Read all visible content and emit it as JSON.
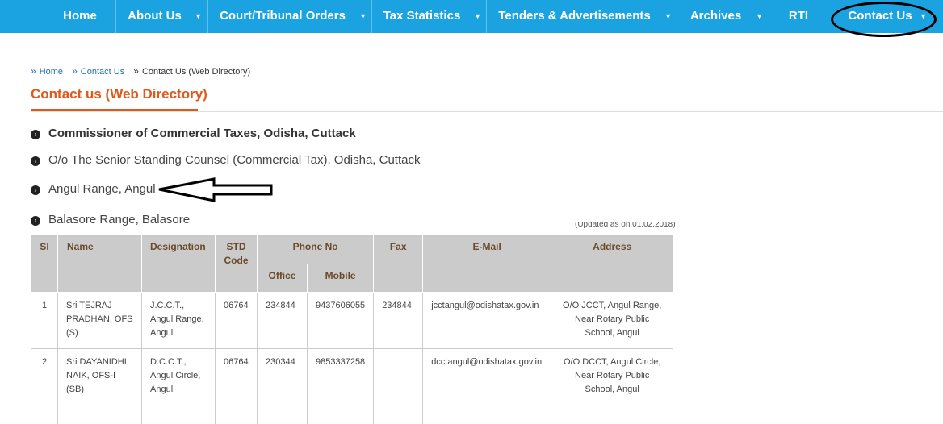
{
  "nav": {
    "items": [
      {
        "label": "Home",
        "dropdown": false
      },
      {
        "label": "About Us",
        "dropdown": true
      },
      {
        "label": "Court/Tribunal Orders",
        "dropdown": true
      },
      {
        "label": "Tax Statistics",
        "dropdown": true
      },
      {
        "label": "Tenders & Advertisements",
        "dropdown": true
      },
      {
        "label": "Archives",
        "dropdown": true
      },
      {
        "label": "RTI",
        "dropdown": false
      },
      {
        "label": "Contact Us",
        "dropdown": true
      }
    ],
    "caret": "▼",
    "bg_color": "#1aa3e0"
  },
  "breadcrumb": {
    "sep": "»",
    "home": "Home",
    "contact": "Contact Us",
    "current": "Contact Us (Web Directory)"
  },
  "page": {
    "title": "Contact us (Web Directory)",
    "accent_color": "#e0591b"
  },
  "offices": [
    {
      "label": "Commissioner of Commercial Taxes, Odisha, Cuttack"
    },
    {
      "label": "O/o The Senior Standing Counsel (Commercial Tax), Odisha, Cuttack"
    },
    {
      "label": "Angul Range, Angul"
    },
    {
      "label": "Balasore Range, Balasore"
    }
  ],
  "bullet_glyph": "›",
  "updated_note": "(Updated as on 01.02.2018)",
  "table": {
    "headers": {
      "sl": "Sl",
      "name": "Name",
      "designation": "Designation",
      "std": "STD Code",
      "phone": "Phone No",
      "office": "Office",
      "mobile": "Mobile",
      "fax": "Fax",
      "email": "E-Mail",
      "address": "Address"
    },
    "rows": [
      {
        "sl": "1",
        "name": "Sri TEJRAJ PRADHAN, OFS (S)",
        "designation": "J.C.C.T., Angul Range, Angul",
        "std": "06764",
        "office": "234844",
        "mobile": "9437606055",
        "fax": "234844",
        "email": "jcctangul@odishatax.gov.in",
        "address": "O/O JCCT, Angul Range, Near Rotary Public School, Angul"
      },
      {
        "sl": "2",
        "name": "Sri DAYANIDHI NAIK, OFS-I (SB)",
        "designation": "D.C.C.T., Angul Circle, Angul",
        "std": "06764",
        "office": "230344",
        "mobile": "9853337258",
        "fax": "",
        "email": "dcctangul@odishatax.gov.in",
        "address": "O/O DCCT, Angul Circle, Near Rotary Public School, Angul"
      }
    ]
  }
}
